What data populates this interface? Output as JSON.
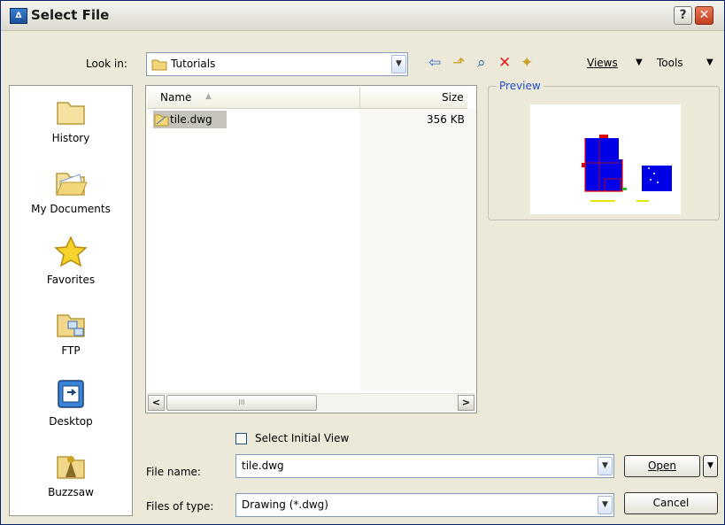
{
  "window": {
    "title": "Select File",
    "help_glyph": "?",
    "close_glyph": "✕"
  },
  "toolbar": {
    "look_in_label": "Look in:",
    "look_in_value": "Tutorials",
    "views_label": "Views",
    "tools_label": "Tools"
  },
  "places": [
    {
      "label": "History",
      "icon": "folder-icon"
    },
    {
      "label": "My Documents",
      "icon": "open-folder-icon"
    },
    {
      "label": "Favorites",
      "icon": "star-icon"
    },
    {
      "label": "FTP",
      "icon": "ftp-icon"
    },
    {
      "label": "Desktop",
      "icon": "desktop-icon"
    },
    {
      "label": "Buzzsaw",
      "icon": "buzzsaw-icon"
    }
  ],
  "file_list": {
    "columns": [
      "Name",
      "Size"
    ],
    "rows": [
      {
        "name": "tile.dwg",
        "size": "356 KB"
      }
    ],
    "scroll_left": "<",
    "scroll_right": ">",
    "scroll_grip": "III"
  },
  "preview": {
    "label": "Preview"
  },
  "options": {
    "select_initial_view": "Select Initial View"
  },
  "file_name": {
    "label": "File name:",
    "value": "tile.dwg"
  },
  "file_type": {
    "label": "Files of type:",
    "value": "Drawing (*.dwg)"
  },
  "buttons": {
    "open": "Open",
    "cancel": "Cancel"
  },
  "colors": {
    "accent": "#1f4ecc",
    "drawing_fill": "#0000e6",
    "drawing_line": "#e00000"
  }
}
